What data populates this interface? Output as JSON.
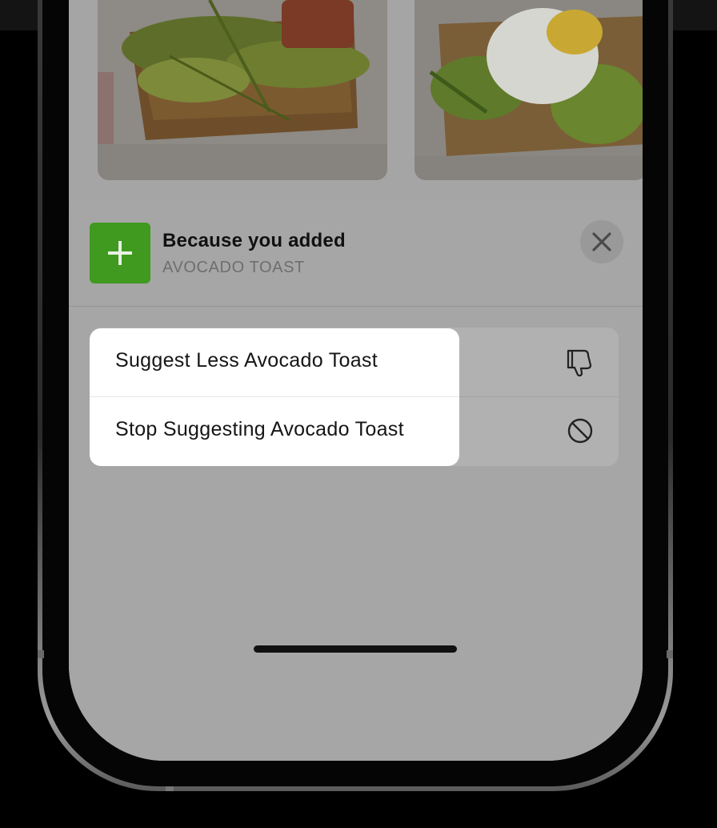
{
  "sheet": {
    "title": "Because you added",
    "subtitle": "AVOCADO TOAST",
    "add_icon": "plus-icon",
    "close_icon": "close-icon"
  },
  "menu": {
    "items": [
      {
        "label": "Suggest Less Avocado Toast",
        "icon": "thumbs-down-icon"
      },
      {
        "label": "Stop Suggesting Avocado Toast",
        "icon": "prohibit-icon"
      }
    ]
  },
  "colors": {
    "accent_green": "#3f9a1f",
    "dimmed_background": "#a5a5a5",
    "menu_background": "#ffffff"
  }
}
